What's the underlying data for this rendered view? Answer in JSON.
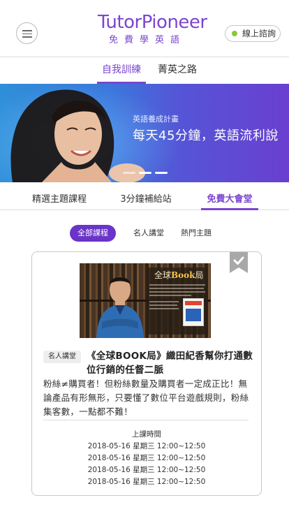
{
  "header": {
    "logo_title": "TutorPioneer",
    "logo_subtitle": "免費學英語",
    "consult_label": "線上諮詢",
    "consult_status_color": "#8bc63f"
  },
  "top_nav": {
    "tabs": [
      {
        "label": "自我訓練",
        "active": true
      },
      {
        "label": "菁英之路",
        "active": false
      }
    ]
  },
  "banner": {
    "subtitle": "英語養成計畫",
    "headline": "每天45分鐘，英語流利說",
    "slide_count": 3,
    "active_slide": 2
  },
  "category_tabs": [
    {
      "label": "精選主題課程",
      "active": false
    },
    {
      "label": "3分鐘補給站",
      "active": false
    },
    {
      "label": "免費大會堂",
      "active": true
    }
  ],
  "filters": [
    {
      "label": "全部課程",
      "active": true
    },
    {
      "label": "名人講堂",
      "active": false
    },
    {
      "label": "熱門主題",
      "active": false
    }
  ],
  "course_card": {
    "thumbnail": {
      "title_prefix": "全球",
      "title_highlight": "Book",
      "title_suffix": "局"
    },
    "tag": "名人講堂",
    "title": "《全球BOOK局》織田紀香幫你打通數位行銷的任督二脈",
    "description": "粉絲≠購買者！但粉絲數量及購買者一定成正比！無論產品有形無形，只要懂了數位平台遊戲規則，粉絲集客數，一點都不難！",
    "schedule_label": "上課時間",
    "schedule": [
      "2018-05-16 星期三 12:00~12:50",
      "2018-05-16 星期三 12:00~12:50",
      "2018-05-16 星期三 12:00~12:50",
      "2018-05-16 星期三 12:00~12:50"
    ]
  },
  "colors": {
    "brand": "#7b45d0",
    "pill_active": "#6a34c8"
  }
}
